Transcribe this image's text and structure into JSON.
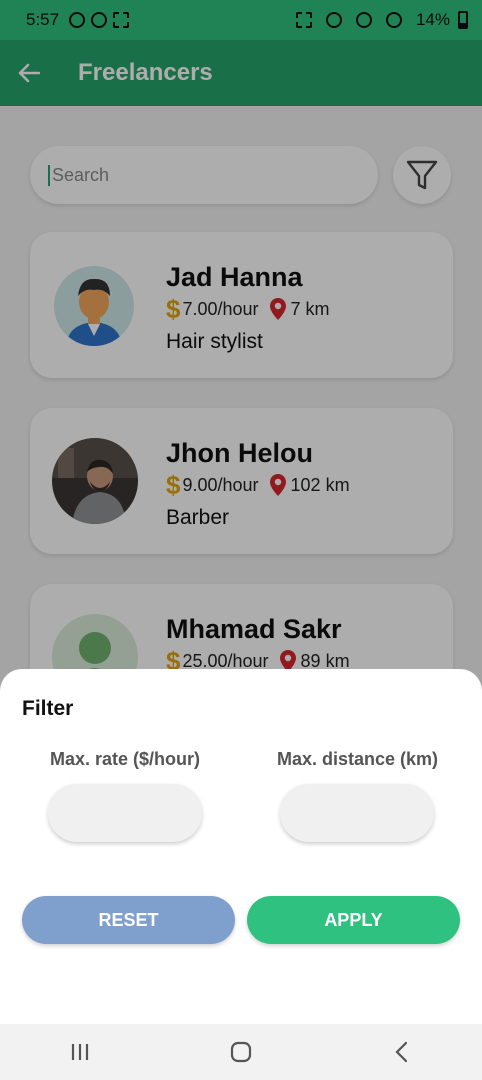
{
  "status_bar": {
    "time": "5:57",
    "battery": "14%"
  },
  "app_bar": {
    "title": "Freelancers",
    "back_icon": "arrow-left-icon"
  },
  "search": {
    "placeholder": "Search",
    "value": ""
  },
  "freelancers": [
    {
      "name": "Jad Hanna",
      "rate": "7.00/hour",
      "distance": "7 km",
      "job": "Hair stylist"
    },
    {
      "name": "Jhon Helou",
      "rate": "9.00/hour",
      "distance": "102 km",
      "job": "Barber"
    },
    {
      "name": "Mhamad Sakr",
      "rate": "25.00/hour",
      "distance": "89 km",
      "job": ""
    }
  ],
  "currency_symbol": "$",
  "filter_sheet": {
    "title": "Filter",
    "max_rate_label": "Max. rate ($/hour)",
    "max_distance_label": "Max. distance (km)",
    "max_rate_value": "",
    "max_distance_value": "",
    "reset_label": "RESET",
    "apply_label": "APPLY"
  },
  "colors": {
    "primary": "#26a46b",
    "status_bar": "#2fc17f",
    "dollar": "#e0a410",
    "pin": "#d8262c",
    "reset_button": "#7f9fcd",
    "apply_button": "#2fc17f"
  }
}
